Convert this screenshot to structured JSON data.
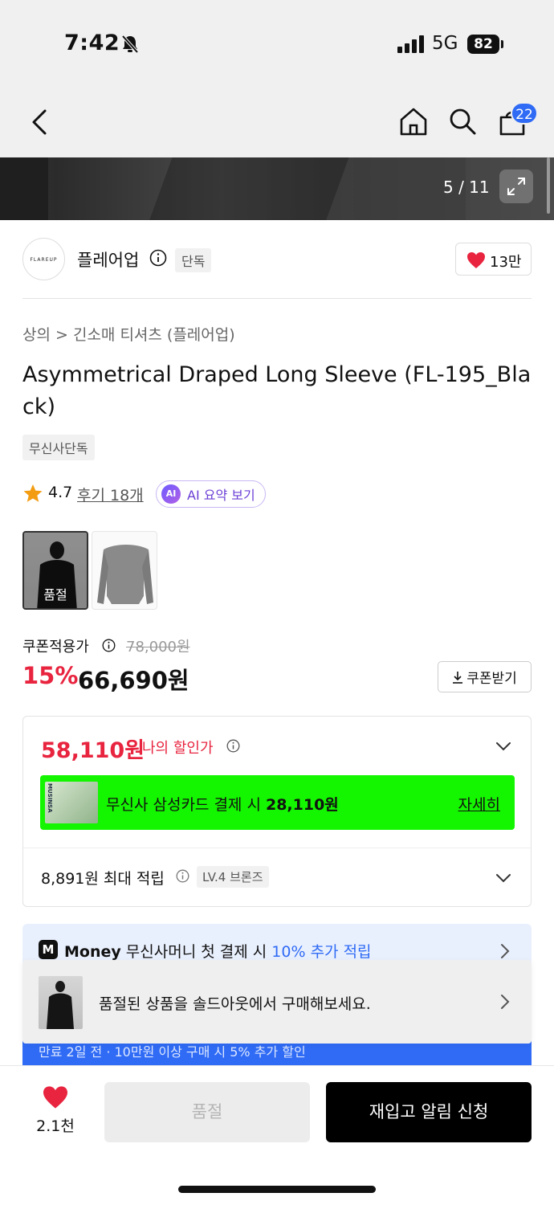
{
  "status": {
    "time": "7:42",
    "network": "5G",
    "battery": "82"
  },
  "header": {
    "cart_count": "22"
  },
  "gallery": {
    "counter": "5 / 11"
  },
  "brand": {
    "logo_text": "FLAREUP",
    "name": "플레어업",
    "exclusive_tag": "단독",
    "likes": "13만"
  },
  "breadcrumb": "상의 > 긴소매 티셔츠 (플레어업)",
  "product": {
    "title": "Asymmetrical Draped Long Sleeve (FL-195_Black)",
    "badge": "무신사단독",
    "rating": "4.7",
    "reviews_label": "후기 18개",
    "ai_badge": "AI",
    "ai_label": "AI 요약 보기",
    "soldout_label": "품절"
  },
  "price": {
    "coupon_label": "쿠폰적용가",
    "original": "78,000원",
    "discount": "15%",
    "sale": "66,690원",
    "coupon_button": "쿠폰받기"
  },
  "benefits": {
    "my_price": "58,110원",
    "my_price_label": "나의 할인가",
    "card_text_prefix": "무신사 삼성카드 결제 시 ",
    "card_text_amount": "28,110원",
    "card_detail": "자세히",
    "points": "8,891원 최대 적립",
    "level": "LV.4 브론즈"
  },
  "money_banner": {
    "logo": "M",
    "brand": "Money",
    "text": " 무신사머니 첫 결제 시 ",
    "accent": "10% 추가 적립",
    "sub": "만료 2일 전 · 10만원 이상 구매 시 5% 추가 할인"
  },
  "toast": {
    "text": "품절된 상품을 솔드아웃에서 구매해보세요."
  },
  "bottom": {
    "wish_count": "2.1천",
    "soldout": "품절",
    "restock": "재입고 알림 신청"
  },
  "colors": {
    "accent_red": "#e8243f",
    "accent_blue": "#2f6bf5",
    "card_green": "#14f500"
  }
}
